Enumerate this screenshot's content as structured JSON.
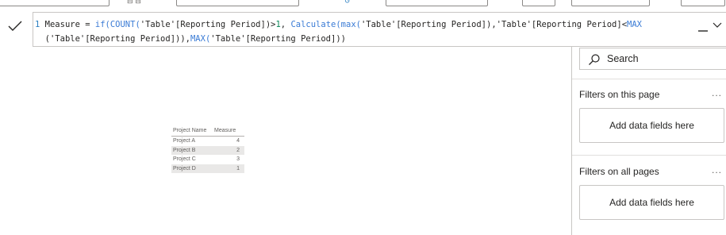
{
  "ribbon": {
    "box_count_left": 2,
    "glyph_left": "⊟ ⊟",
    "glyph_blue": "↺"
  },
  "formula_bar": {
    "line_number": "1",
    "line1": {
      "p1": "Measure = ",
      "f1": "if(",
      "f2": "COUNT(",
      "p2": "'Table'[Reporting Period])>",
      "n1": "1",
      "p3": ", ",
      "f3": "Calculate(",
      "f4": "max(",
      "p4": "'Table'[Reporting Period]),'Table'[Reporting Period]<",
      "f5": "MAX"
    },
    "line2": {
      "p1": "('Table'[Reporting Period])),",
      "f1": "MAX(",
      "p2": "'Table'[Reporting Period]))"
    }
  },
  "filters": {
    "search_label": "Search",
    "this_page_title": "Filters on this page",
    "this_page_more": "...",
    "this_page_drop": "Add data fields here",
    "all_pages_title": "Filters on all pages",
    "all_pages_more": "...",
    "all_pages_drop": "Add data fields here"
  },
  "table": {
    "columns": [
      "Project Name",
      "Measure"
    ],
    "rows": [
      {
        "name": "Project A",
        "value": "4"
      },
      {
        "name": "Project B",
        "value": "2"
      },
      {
        "name": "Project C",
        "value": "3"
      },
      {
        "name": "Project D",
        "value": "1"
      }
    ]
  },
  "colors": {
    "function_blue": "#3a7bd5",
    "number_green": "#098658",
    "row_shade": "#e9e8e7"
  }
}
